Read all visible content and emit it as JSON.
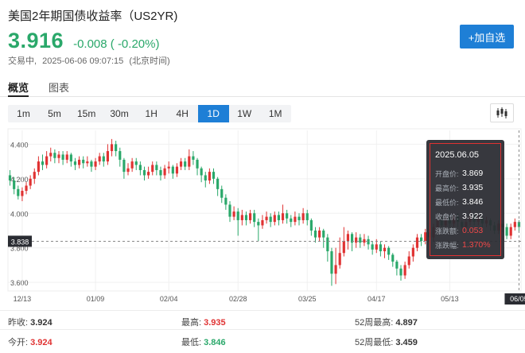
{
  "header": {
    "title": "美国2年期国债收益率（US2YR)",
    "price": "3.916",
    "change": "-0.008 ( -0.20%)",
    "status": "交易中,",
    "time": "2025-06-06 09:07:15",
    "zone": "(北京时间)",
    "follow_label": "+加自选"
  },
  "tabs": [
    {
      "label": "概览",
      "active": true
    },
    {
      "label": "图表",
      "active": false
    }
  ],
  "periods": [
    {
      "label": "1m",
      "active": false
    },
    {
      "label": "5m",
      "active": false
    },
    {
      "label": "15m",
      "active": false
    },
    {
      "label": "30m",
      "active": false
    },
    {
      "label": "1H",
      "active": false
    },
    {
      "label": "4H",
      "active": false
    },
    {
      "label": "1D",
      "active": true
    },
    {
      "label": "1W",
      "active": false
    },
    {
      "label": "1M",
      "active": false
    }
  ],
  "colors": {
    "up": "#e03232",
    "down": "#2aa86a",
    "accent": "#1e7fd6"
  },
  "chart_data": {
    "type": "candlestick",
    "y_ticks": [
      "4.400",
      "4.200",
      "4.000",
      "3.800",
      "3.600"
    ],
    "ylim": [
      3.55,
      4.48
    ],
    "x_ticks": [
      {
        "label": "12/13",
        "index": 3
      },
      {
        "label": "01/09",
        "index": 21
      },
      {
        "label": "02/04",
        "index": 39
      },
      {
        "label": "02/28",
        "index": 56
      },
      {
        "label": "03/25",
        "index": 73
      },
      {
        "label": "04/17",
        "index": 90
      },
      {
        "label": "05/13",
        "index": 108
      }
    ],
    "crosshair_value": "3.838",
    "crosshair_date": "06/05",
    "crosshair_index": 125,
    "candles": [
      [
        4.22,
        4.19,
        4.25,
        4.16
      ],
      [
        4.19,
        4.14,
        4.21,
        4.11
      ],
      [
        4.14,
        4.1,
        4.16,
        4.08
      ],
      [
        4.1,
        4.13,
        4.15,
        4.07
      ],
      [
        4.13,
        4.16,
        4.18,
        4.11
      ],
      [
        4.16,
        4.2,
        4.22,
        4.14
      ],
      [
        4.2,
        4.24,
        4.26,
        4.17
      ],
      [
        4.24,
        4.3,
        4.33,
        4.22
      ],
      [
        4.3,
        4.28,
        4.34,
        4.25
      ],
      [
        4.28,
        4.33,
        4.36,
        4.26
      ],
      [
        4.33,
        4.35,
        4.38,
        4.3
      ],
      [
        4.35,
        4.32,
        4.37,
        4.29
      ],
      [
        4.32,
        4.34,
        4.36,
        4.29
      ],
      [
        4.34,
        4.31,
        4.36,
        4.28
      ],
      [
        4.31,
        4.34,
        4.36,
        4.29
      ],
      [
        4.34,
        4.3,
        4.35,
        4.27
      ],
      [
        4.3,
        4.28,
        4.32,
        4.25
      ],
      [
        4.28,
        4.31,
        4.33,
        4.26
      ],
      [
        4.31,
        4.29,
        4.33,
        4.26
      ],
      [
        4.29,
        4.3,
        4.33,
        4.27
      ],
      [
        4.3,
        4.27,
        4.31,
        4.24
      ],
      [
        4.27,
        4.3,
        4.32,
        4.25
      ],
      [
        4.3,
        4.33,
        4.35,
        4.28
      ],
      [
        4.33,
        4.3,
        4.35,
        4.27
      ],
      [
        4.3,
        4.36,
        4.4,
        4.28
      ],
      [
        4.36,
        4.4,
        4.43,
        4.33
      ],
      [
        4.4,
        4.36,
        4.42,
        4.33
      ],
      [
        4.36,
        4.31,
        4.38,
        4.27
      ],
      [
        4.31,
        4.24,
        4.32,
        4.2
      ],
      [
        4.24,
        4.26,
        4.29,
        4.22
      ],
      [
        4.26,
        4.3,
        4.32,
        4.24
      ],
      [
        4.3,
        4.28,
        4.32,
        4.25
      ],
      [
        4.28,
        4.25,
        4.3,
        4.22
      ],
      [
        4.25,
        4.22,
        4.27,
        4.19
      ],
      [
        4.22,
        4.24,
        4.27,
        4.2
      ],
      [
        4.24,
        4.28,
        4.3,
        4.22
      ],
      [
        4.28,
        4.25,
        4.3,
        4.22
      ],
      [
        4.25,
        4.22,
        4.27,
        4.19
      ],
      [
        4.22,
        4.26,
        4.28,
        4.2
      ],
      [
        4.26,
        4.27,
        4.3,
        4.23
      ],
      [
        4.27,
        4.23,
        4.28,
        4.2
      ],
      [
        4.23,
        4.27,
        4.29,
        4.21
      ],
      [
        4.27,
        4.3,
        4.32,
        4.25
      ],
      [
        4.3,
        4.27,
        4.32,
        4.25
      ],
      [
        4.27,
        4.33,
        4.37,
        4.25
      ],
      [
        4.33,
        4.31,
        4.36,
        4.28
      ],
      [
        4.31,
        4.26,
        4.32,
        4.22
      ],
      [
        4.26,
        4.22,
        4.27,
        4.18
      ],
      [
        4.22,
        4.19,
        4.24,
        4.15
      ],
      [
        4.19,
        4.24,
        4.26,
        4.17
      ],
      [
        4.24,
        4.2,
        4.26,
        4.17
      ],
      [
        4.2,
        4.14,
        4.21,
        4.1
      ],
      [
        4.14,
        4.09,
        4.16,
        4.06
      ],
      [
        4.09,
        4.05,
        4.11,
        4.02
      ],
      [
        4.05,
        3.98,
        4.07,
        3.95
      ],
      [
        3.98,
        4.01,
        4.04,
        3.96
      ],
      [
        4.01,
        3.96,
        4.03,
        3.87
      ],
      [
        3.96,
        3.99,
        4.02,
        3.93
      ],
      [
        3.99,
        3.96,
        4.01,
        3.93
      ],
      [
        3.96,
        4.0,
        4.02,
        3.94
      ],
      [
        4.0,
        3.95,
        4.02,
        3.92
      ],
      [
        3.95,
        3.93,
        3.97,
        3.84
      ],
      [
        3.93,
        3.96,
        3.99,
        3.91
      ],
      [
        3.96,
        3.98,
        4.01,
        3.94
      ],
      [
        3.98,
        3.95,
        4.0,
        3.92
      ],
      [
        3.95,
        3.99,
        4.01,
        3.93
      ],
      [
        3.99,
        3.96,
        4.01,
        3.93
      ],
      [
        3.96,
        4.0,
        4.05,
        3.94
      ],
      [
        4.0,
        3.97,
        4.02,
        3.94
      ],
      [
        3.97,
        3.95,
        3.99,
        3.92
      ],
      [
        3.95,
        3.98,
        4.01,
        3.93
      ],
      [
        3.98,
        3.96,
        4.0,
        3.93
      ],
      [
        3.96,
        4.0,
        4.03,
        3.94
      ],
      [
        4.0,
        3.96,
        4.02,
        3.93
      ],
      [
        3.96,
        3.9,
        3.97,
        3.87
      ],
      [
        3.9,
        3.86,
        3.92,
        3.83
      ],
      [
        3.86,
        3.9,
        3.92,
        3.84
      ],
      [
        3.9,
        3.86,
        3.91,
        3.8
      ],
      [
        3.86,
        3.78,
        3.88,
        3.72
      ],
      [
        3.78,
        3.65,
        3.8,
        3.58
      ],
      [
        3.65,
        3.7,
        3.8,
        3.59
      ],
      [
        3.7,
        3.77,
        3.86,
        3.68
      ],
      [
        3.77,
        3.84,
        3.92,
        3.75
      ],
      [
        3.84,
        3.88,
        3.9,
        3.79
      ],
      [
        3.88,
        3.83,
        3.89,
        3.78
      ],
      [
        3.83,
        3.86,
        3.89,
        3.8
      ],
      [
        3.86,
        3.83,
        3.88,
        3.8
      ],
      [
        3.83,
        3.85,
        3.88,
        3.81
      ],
      [
        3.85,
        3.82,
        3.87,
        3.79
      ],
      [
        3.82,
        3.79,
        3.84,
        3.76
      ],
      [
        3.79,
        3.82,
        3.85,
        3.77
      ],
      [
        3.82,
        3.78,
        3.84,
        3.75
      ],
      [
        3.78,
        3.8,
        3.82,
        3.74
      ],
      [
        3.8,
        3.76,
        3.81,
        3.73
      ],
      [
        3.76,
        3.72,
        3.77,
        3.69
      ],
      [
        3.72,
        3.68,
        3.73,
        3.64
      ],
      [
        3.68,
        3.64,
        3.7,
        3.61
      ],
      [
        3.64,
        3.7,
        3.72,
        3.62
      ],
      [
        3.7,
        3.75,
        3.78,
        3.68
      ],
      [
        3.75,
        3.8,
        3.82,
        3.72
      ],
      [
        3.8,
        3.86,
        3.88,
        3.78
      ],
      [
        3.86,
        3.84,
        3.88,
        3.81
      ],
      [
        3.84,
        3.89,
        3.91,
        3.82
      ],
      [
        3.89,
        3.86,
        3.91,
        3.84
      ],
      [
        3.86,
        3.92,
        3.94,
        3.84
      ],
      [
        3.92,
        3.96,
        3.98,
        3.9
      ],
      [
        3.96,
        3.93,
        3.98,
        3.91
      ],
      [
        3.93,
        3.97,
        3.99,
        3.91
      ],
      [
        3.97,
        3.94,
        3.99,
        3.92
      ],
      [
        3.94,
        3.98,
        4.0,
        3.92
      ],
      [
        3.98,
        3.95,
        4.0,
        3.92
      ],
      [
        3.95,
        3.92,
        3.96,
        3.89
      ],
      [
        3.92,
        3.95,
        3.97,
        3.9
      ],
      [
        3.95,
        3.98,
        4.02,
        3.93
      ],
      [
        3.98,
        3.95,
        4.0,
        3.93
      ],
      [
        3.95,
        3.97,
        3.99,
        3.93
      ],
      [
        3.97,
        3.94,
        3.98,
        3.92
      ],
      [
        3.94,
        3.96,
        3.98,
        3.92
      ],
      [
        3.96,
        3.93,
        3.97,
        3.9
      ],
      [
        3.93,
        3.9,
        3.95,
        3.88
      ],
      [
        3.9,
        3.94,
        3.96,
        3.88
      ],
      [
        3.94,
        3.92,
        3.96,
        3.89
      ],
      [
        3.92,
        3.87,
        3.94,
        3.85
      ],
      [
        3.87,
        3.92,
        3.94,
        3.85
      ],
      [
        3.92,
        3.95,
        3.97,
        3.9
      ],
      [
        3.95,
        3.92,
        3.96,
        3.89
      ]
    ]
  },
  "tooltip": {
    "date": "2025.06.05",
    "rows": [
      {
        "label": "开盘价:",
        "value": "3.869",
        "highlight": false
      },
      {
        "label": "最高价:",
        "value": "3.935",
        "highlight": false
      },
      {
        "label": "最低价:",
        "value": "3.846",
        "highlight": false
      },
      {
        "label": "收盘价:",
        "value": "3.922",
        "highlight": false
      },
      {
        "label": "涨跌额:",
        "value": "0.053",
        "highlight": true
      },
      {
        "label": "涨跌幅:",
        "value": "1.370%",
        "highlight": true
      }
    ]
  },
  "stats": {
    "prev_close_label": "昨收:",
    "prev_close": "3.924",
    "open_label": "今开:",
    "open": "3.924",
    "high_label": "最高:",
    "high": "3.935",
    "low_label": "最低:",
    "low": "3.846",
    "wk52_high_label": "52周最高:",
    "wk52_high": "4.897",
    "wk52_low_label": "52周最低:",
    "wk52_low": "3.459"
  }
}
